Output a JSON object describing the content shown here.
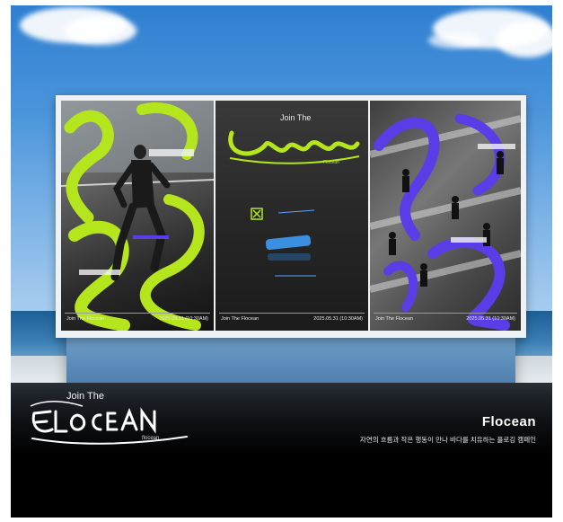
{
  "colors": {
    "sky": "#4c95dc",
    "lime": "#b5e61d",
    "violet": "#5a3de6",
    "ground": "#000000"
  },
  "poster_left": {
    "footer_left": "Join The Flocean",
    "footer_date": "2025.05.31 (10:30AM)"
  },
  "poster_center": {
    "headline": "Join The",
    "logo": "FLOCEAN",
    "logo_sub": "Flocean",
    "footer_left": "Join The Flocean",
    "footer_date": "2025.05.31 (10:30AM)"
  },
  "poster_right": {
    "footer_left": "Join The Flocean",
    "footer_date": "2025.05.31 (10:30AM)"
  },
  "footer": {
    "title_line": "Join The",
    "logo_word": "FLOCEAN",
    "logo_sub": "flocean",
    "brand": "Flocean",
    "tagline": "자연의 흐름과 작은 행동이 만나 바다를 치유하는 플로깅 캠페인"
  }
}
